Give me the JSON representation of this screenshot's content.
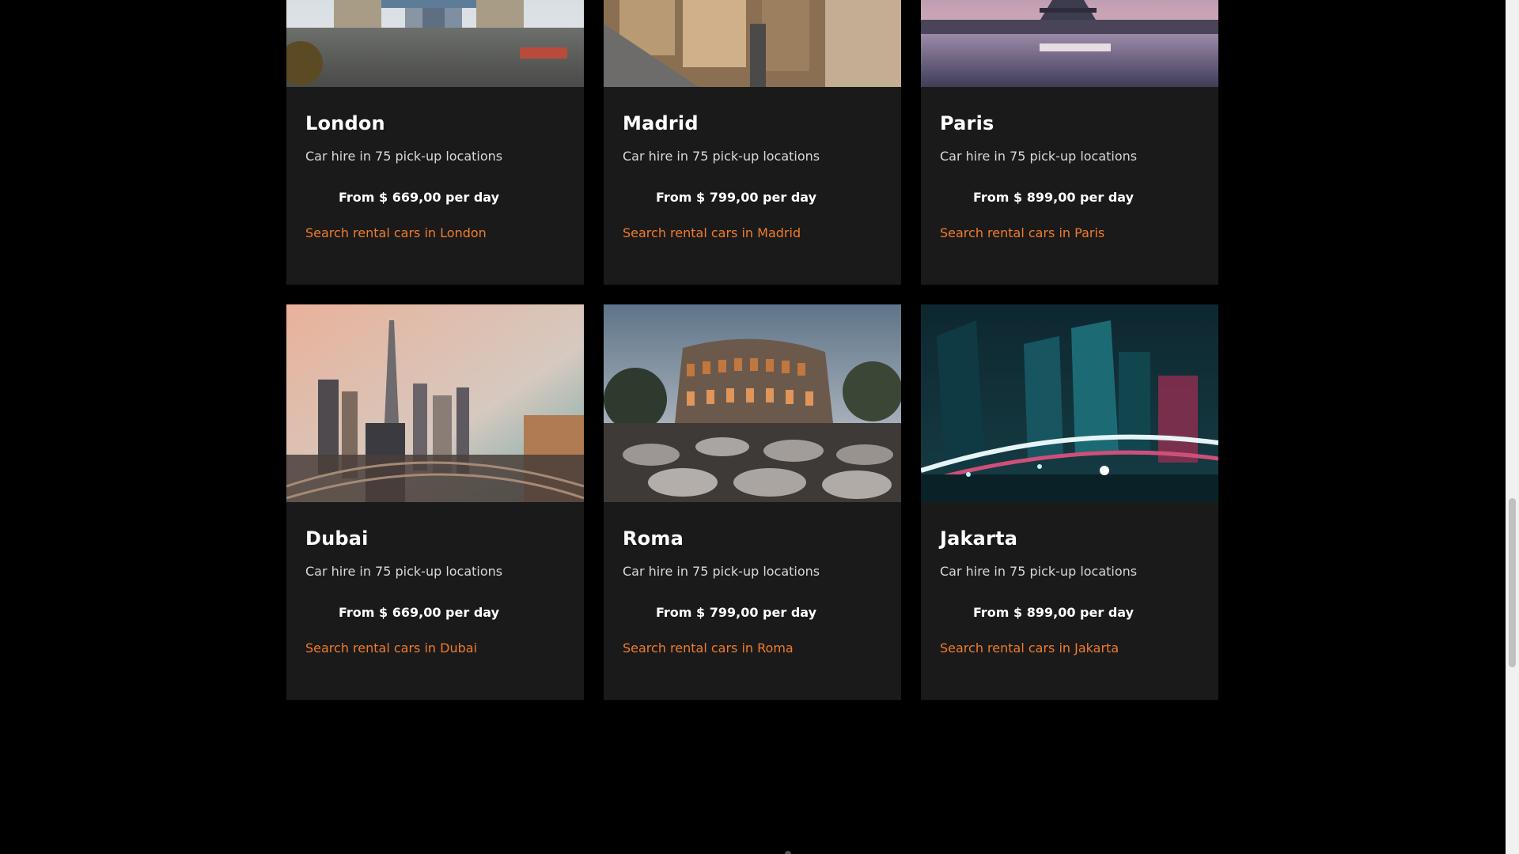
{
  "cards": [
    {
      "city": "London",
      "locations": "Car hire in 75 pick-up locations",
      "price": "From $ 669,00 per day",
      "link": "Search rental cars in London",
      "photo_icon": "tower-bridge-photo"
    },
    {
      "city": "Madrid",
      "locations": "Car hire in 75 pick-up locations",
      "price": "From $ 799,00 per day",
      "link": "Search rental cars in Madrid",
      "photo_icon": "madrid-cityscape-photo"
    },
    {
      "city": "Paris",
      "locations": "Car hire in 75 pick-up locations",
      "price": "From $ 899,00 per day",
      "link": "Search rental cars in Paris",
      "photo_icon": "eiffel-tower-photo"
    },
    {
      "city": "Dubai",
      "locations": "Car hire in 75 pick-up locations",
      "price": "From $ 669,00 per day",
      "link": "Search rental cars in Dubai",
      "photo_icon": "dubai-skyline-photo"
    },
    {
      "city": "Roma",
      "locations": "Car hire in 75 pick-up locations",
      "price": "From $ 799,00 per day",
      "link": "Search rental cars in Roma",
      "photo_icon": "colosseum-photo"
    },
    {
      "city": "Jakarta",
      "locations": "Car hire in 75 pick-up locations",
      "price": "From $ 899,00 per day",
      "link": "Search rental cars in Jakarta",
      "photo_icon": "jakarta-night-photo"
    }
  ],
  "colors": {
    "background": "#000000",
    "card": "#1a1a1a",
    "link": "#f07c2c",
    "text": "#ffffff"
  }
}
